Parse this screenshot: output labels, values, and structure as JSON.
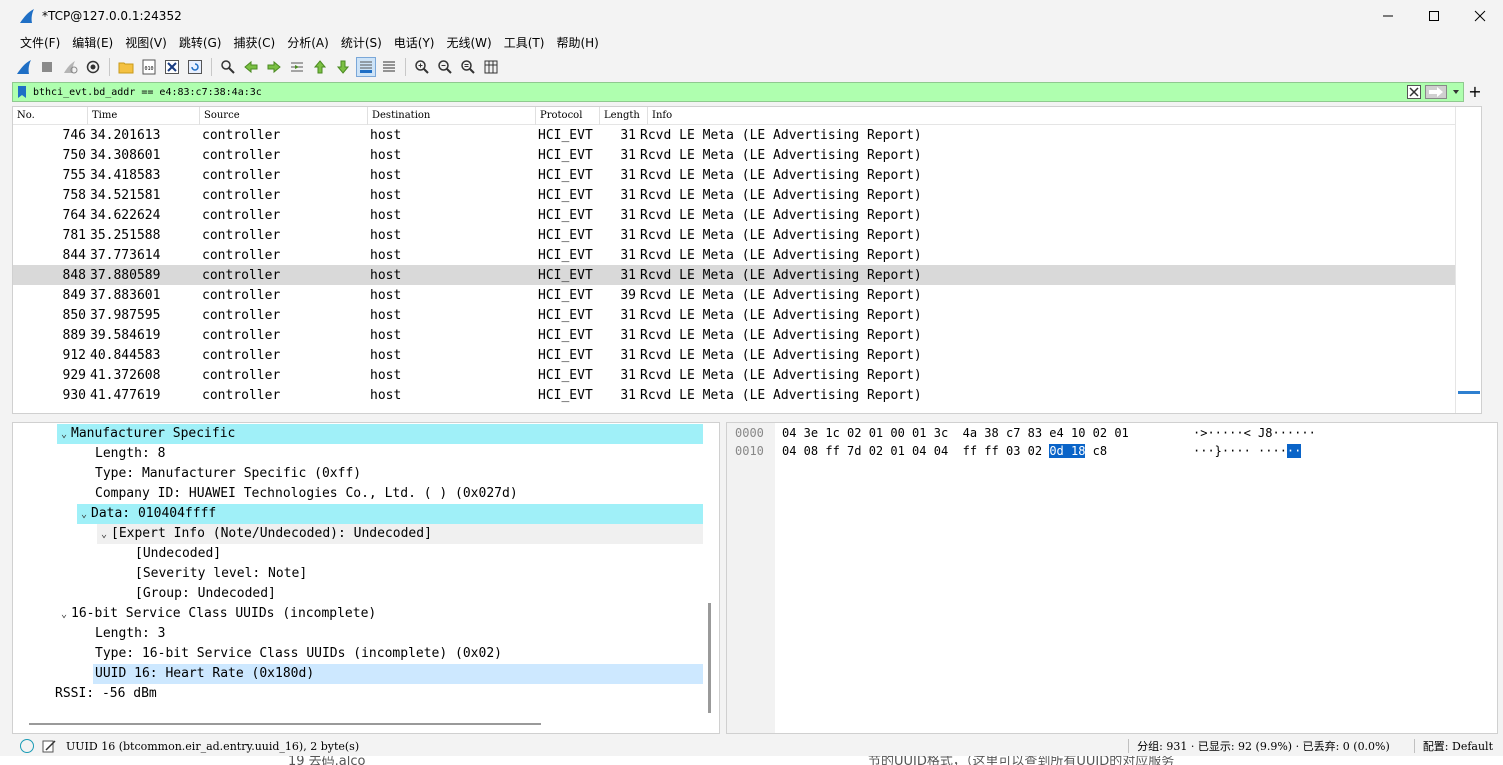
{
  "window": {
    "title": "*TCP@127.0.0.1:24352"
  },
  "menu": [
    "文件(F)",
    "编辑(E)",
    "视图(V)",
    "跳转(G)",
    "捕获(C)",
    "分析(A)",
    "统计(S)",
    "电话(Y)",
    "无线(W)",
    "工具(T)",
    "帮助(H)"
  ],
  "filter": {
    "value": "bthci_evt.bd_addr == e4:83:c7:38:4a:3c"
  },
  "columns": [
    "No.",
    "Time",
    "Source",
    "Destination",
    "Protocol",
    "Length",
    "Info"
  ],
  "packets": [
    {
      "no": "746",
      "time": "34.201613",
      "src": "controller",
      "dst": "host",
      "proto": "HCI_EVT",
      "len": "31",
      "info": "Rcvd LE Meta (LE Advertising Report)"
    },
    {
      "no": "750",
      "time": "34.308601",
      "src": "controller",
      "dst": "host",
      "proto": "HCI_EVT",
      "len": "31",
      "info": "Rcvd LE Meta (LE Advertising Report)"
    },
    {
      "no": "755",
      "time": "34.418583",
      "src": "controller",
      "dst": "host",
      "proto": "HCI_EVT",
      "len": "31",
      "info": "Rcvd LE Meta (LE Advertising Report)"
    },
    {
      "no": "758",
      "time": "34.521581",
      "src": "controller",
      "dst": "host",
      "proto": "HCI_EVT",
      "len": "31",
      "info": "Rcvd LE Meta (LE Advertising Report)"
    },
    {
      "no": "764",
      "time": "34.622624",
      "src": "controller",
      "dst": "host",
      "proto": "HCI_EVT",
      "len": "31",
      "info": "Rcvd LE Meta (LE Advertising Report)"
    },
    {
      "no": "781",
      "time": "35.251588",
      "src": "controller",
      "dst": "host",
      "proto": "HCI_EVT",
      "len": "31",
      "info": "Rcvd LE Meta (LE Advertising Report)"
    },
    {
      "no": "844",
      "time": "37.773614",
      "src": "controller",
      "dst": "host",
      "proto": "HCI_EVT",
      "len": "31",
      "info": "Rcvd LE Meta (LE Advertising Report)"
    },
    {
      "no": "848",
      "time": "37.880589",
      "src": "controller",
      "dst": "host",
      "proto": "HCI_EVT",
      "len": "31",
      "info": "Rcvd LE Meta (LE Advertising Report)"
    },
    {
      "no": "849",
      "time": "37.883601",
      "src": "controller",
      "dst": "host",
      "proto": "HCI_EVT",
      "len": "39",
      "info": "Rcvd LE Meta (LE Advertising Report)"
    },
    {
      "no": "850",
      "time": "37.987595",
      "src": "controller",
      "dst": "host",
      "proto": "HCI_EVT",
      "len": "31",
      "info": "Rcvd LE Meta (LE Advertising Report)"
    },
    {
      "no": "889",
      "time": "39.584619",
      "src": "controller",
      "dst": "host",
      "proto": "HCI_EVT",
      "len": "31",
      "info": "Rcvd LE Meta (LE Advertising Report)"
    },
    {
      "no": "912",
      "time": "40.844583",
      "src": "controller",
      "dst": "host",
      "proto": "HCI_EVT",
      "len": "31",
      "info": "Rcvd LE Meta (LE Advertising Report)"
    },
    {
      "no": "929",
      "time": "41.372608",
      "src": "controller",
      "dst": "host",
      "proto": "HCI_EVT",
      "len": "31",
      "info": "Rcvd LE Meta (LE Advertising Report)"
    },
    {
      "no": "930",
      "time": "41.477619",
      "src": "controller",
      "dst": "host",
      "proto": "HCI_EVT",
      "len": "31",
      "info": "Rcvd LE Meta (LE Advertising Report)"
    }
  ],
  "details": {
    "manufacturer_specific": "Manufacturer Specific",
    "ms_length": "Length: 8",
    "ms_type": "Type: Manufacturer Specific (0xff)",
    "ms_company": "Company ID: HUAWEI Technologies Co., Ltd. ( ) (0x027d)",
    "ms_data": "Data: 010404ffff",
    "expert_info": "[Expert Info (Note/Undecoded): Undecoded]",
    "undecoded": "[Undecoded]",
    "severity": "[Severity level: Note]",
    "group": "[Group: Undecoded]",
    "uuid_header": "16-bit Service Class UUIDs (incomplete)",
    "uuid_length": "Length: 3",
    "uuid_type": "Type: 16-bit Service Class UUIDs (incomplete) (0x02)",
    "uuid16": "UUID 16: Heart Rate (0x180d)",
    "rssi": "RSSI: -56 dBm"
  },
  "bytes": {
    "line1_offset": "0000",
    "line1_hex": "04 3e 1c 02 01 00 01 3c  4a 38 c7 83 e4 10 02 01",
    "line1_ascii": "·>·····< J8······",
    "line2_offset": "0010",
    "line2_hex_a": "04 08 ff 7d 02 01 04 04  ff ff 03 02 ",
    "line2_hex_sel": "0d 18",
    "line2_hex_b": " c8",
    "line2_ascii_a": "···}···· ····",
    "line2_ascii_sel": "··"
  },
  "status": {
    "field": "UUID 16 (btcommon.eir_ad.entry.uuid_16), 2 byte(s)",
    "packets": "分组: 931 · 已显示: 92 (9.9%) · 已丢弃: 0 (0.0%)",
    "profile": "配置: Default"
  },
  "background_text": {
    "left": "19    去码.alco",
    "right": "节的UUID格式，（这里可以查到所有UUID的对应服务"
  },
  "colors": {
    "filter_bg": "#afffaf",
    "selected_row": "#d9d9d9",
    "tree_highlight_cyan": "#a0f0f8",
    "tree_highlight_blue": "#cde8ff",
    "byte_select": "#0a64c8"
  }
}
